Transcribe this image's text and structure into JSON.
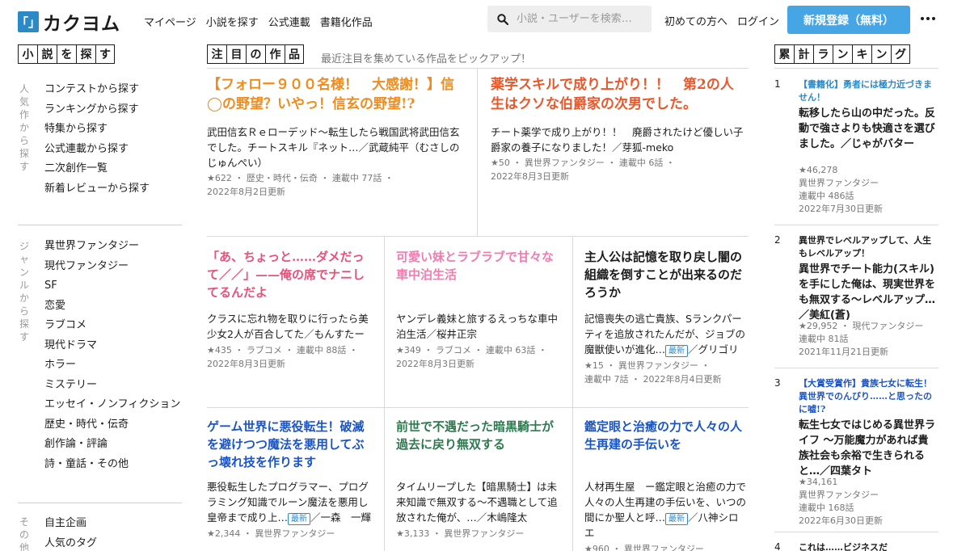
{
  "header": {
    "logo_mark": "「」",
    "logo_text": "カクヨム",
    "nav": [
      "マイページ",
      "小説を探す",
      "公式連載",
      "書籍化作品"
    ],
    "search_placeholder": "小説・ユーザーを検索…",
    "beginner": "初めての方へ",
    "login": "ログイン",
    "register": "新規登録（無料）"
  },
  "sidebar": {
    "title": [
      "小",
      "説",
      "を",
      "探",
      "す"
    ],
    "group1_label": "人気作から探す",
    "group1_items": [
      "コンテストから探す",
      "ランキングから探す",
      "特集から探す",
      "公式連載から探す",
      "二次創作一覧",
      "新着レビューから探す"
    ],
    "group2_label": "ジャンルから探す",
    "group2_items": [
      "異世界ファンタジー",
      "現代ファンタジー",
      "SF",
      "恋愛",
      "ラブコメ",
      "現代ドラマ",
      "ホラー",
      "ミステリー",
      "エッセイ・ノンフィクション",
      "歴史・時代・伝奇",
      "創作論・評論",
      "詩・童話・その他"
    ],
    "group3_label": "その他",
    "group3_items": [
      "自主企画",
      "人気のタグ"
    ]
  },
  "featured": {
    "title": [
      "注",
      "目",
      "の",
      "作",
      "品"
    ],
    "subtitle": "最近注目を集めている作品をピックアップ！",
    "cards": [
      {
        "catch": "【フォロー９００名様！　大感謝！】信◯の野望？いやっ！信玄の野望!?",
        "color": "#f08c1e",
        "desc": "武田信玄Ｒｅローデッド〜転生したら戦国武将武田信玄でした。チートスキル『ネット…／武蔵純平（むさしのじゅんぺい）",
        "meta1": "★622 ・ 歴史・時代・伝奇 ・ 連載中 77話 ・",
        "meta2": "2022年8月2日更新"
      },
      {
        "catch": "薬学スキルで成り上がり！！　第2の人生はクソな伯爵家の次男でした。",
        "color": "#e9572a",
        "desc": "チート薬学で成り上がり！！　廃爵されたけど優しい子爵家の養子になりました！／芽狐-meko",
        "meta1": "★50 ・ 異世界ファンタジー ・ 連載中 6話 ・",
        "meta2": "2022年8月3日更新"
      },
      {
        "catch": "「あ、ちょっと……ダメだって／／」——俺の席でナニしてるんだよ",
        "color": "#e8517a",
        "desc": "クラスに忘れ物を取りに行ったら美少女2人が百合してた／もんすたー",
        "meta1": "★435 ・ ラブコメ ・ 連載中 88話 ・",
        "meta2": "2022年8月3日更新"
      },
      {
        "catch": "可愛い妹とラブラブで甘々な車中泊生活",
        "color": "#f37bb0",
        "desc": "ヤンデレ義妹と旅するえっちな車中泊生活／桜井正宗",
        "meta1": "★349 ・ ラブコメ ・ 連載中 63話 ・",
        "meta2": "2022年8月3日更新"
      },
      {
        "catch": "主人公は記憶を取り戻し闇の組織を倒すことが出来るのだろうか",
        "color": "#1c1c1c",
        "desc": "記憶喪失の逃亡貴族、Sランクパーティを追放されたんだが、ジョブの魔獣使いが進化…",
        "badge": "最新",
        "desc_tail": "／グリゴリ",
        "meta1": "★15 ・ 異世界ファンタジー ・",
        "meta2": "連載中 7話 ・ 2022年8月4日更新"
      },
      {
        "catch": "ゲーム世界に悪役転生！破滅を避けつつ魔法を悪用してぶっ壊れ技を作ります",
        "color": "#1a55c8",
        "desc": "悪役転生したプログラマー、プログラミング知識でルーン魔法を悪用し皇帝まで成り上…",
        "badge": "最新",
        "desc_tail": "／一森　一輝",
        "meta1": "★2,344 ・ 異世界ファンタジー"
      },
      {
        "catch": "前世で不遇だった暗黒騎士が過去に戻り無双する",
        "color": "#2e7a4f",
        "desc": "タイムリープした【暗黒騎士】は未来知識で無双する〜不遇職として追放された俺が、…／木嶋隆太",
        "meta1": "★3,133 ・ 異世界ファンタジー"
      },
      {
        "catch": "鑑定眼と治癒の力で人々の人生再建の手伝いを",
        "color": "#1a55c8",
        "desc": "人材再生屋　ー鑑定眼と治癒の力で人々の人生再建の手伝いを、いつの間にか聖人と呼…",
        "badge": "最新",
        "desc_tail": "／八神シロエ",
        "meta1": "★960 ・ 異世界ファンタジー"
      }
    ]
  },
  "ranking": {
    "title": [
      "累",
      "計",
      "ラ",
      "ン",
      "キ",
      "ン",
      "グ"
    ],
    "items": [
      {
        "num": "1",
        "catch": "【書籍化】勇者には極力近づきません！",
        "catch_color": "#2a8ac8",
        "title": "転移したら山の中だった。反動で強さよりも快適さを選びました。／じゃがバター",
        "meta": [
          "★46,278",
          "異世界ファンタジー",
          "連載中 486話",
          "2022年7月30日更新"
        ]
      },
      {
        "num": "2",
        "catch": "異世界でレベルアップして、人生もレベルアップ！",
        "catch_color": "#1c1c1c",
        "title": "異世界でチート能力(スキル)を手にした俺は、現実世界をも無双する〜レベルアップ…／美紅(蒼)",
        "meta": [
          "★29,952 ・ 現代ファンタジー",
          "連載中 81話",
          "2021年11月21日更新"
        ]
      },
      {
        "num": "3",
        "catch": "【大賞受賞作】貴族七女に転生！異世界でのんびり……と思ったのに嘘!?",
        "catch_color": "#1a55c8",
        "title": "転生七女ではじめる異世界ライフ 〜万能魔力があれば貴族社会も余裕で生きられると…／四葉タト",
        "meta": [
          "★34,161",
          "異世界ファンタジー",
          "連載中 168話",
          "2022年6月30日更新"
        ]
      },
      {
        "num": "4",
        "catch": "これは……ビジネスだ",
        "catch_color": "#1c1c1c"
      }
    ]
  }
}
